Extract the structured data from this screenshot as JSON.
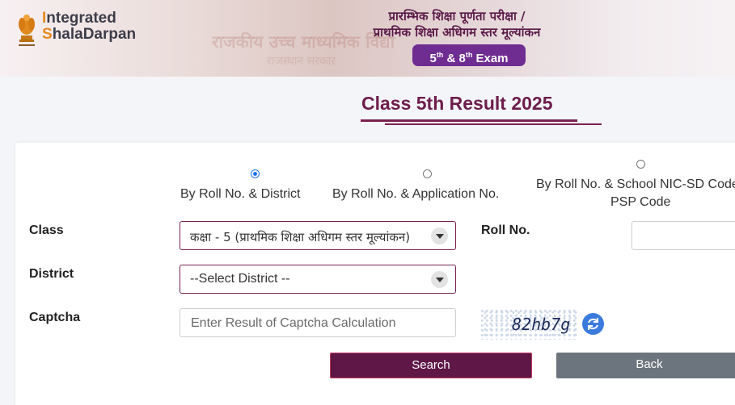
{
  "header": {
    "logo_line1_initial": "I",
    "logo_line1_rest": "ntegrated",
    "logo_line2_initial": "S",
    "logo_line2_rest": "halaDarpan",
    "exam_title_line1": "प्रारम्भिक शिक्षा पूर्णता परीक्षा /",
    "exam_title_line2": "प्राथमिक शिक्षा अधिगम स्तर मूल्यांकन",
    "badge_a": "5",
    "badge_a_sup": "th",
    "badge_mid": " & 8",
    "badge_b_sup": "th",
    "badge_end": " Exam",
    "background_text": "राजकीय उच्च माध्यमिक विद्या",
    "background_text2": "राजस्थान सरकार"
  },
  "page": {
    "title": "Class 5th Result 2025"
  },
  "search_options": [
    {
      "label": "By Roll No. & District",
      "selected": true
    },
    {
      "label": "By Roll No. & Application No.",
      "selected": false
    },
    {
      "label_line1": "By Roll No. & School NIC-SD Code",
      "label_line2": "PSP Code",
      "selected": false
    }
  ],
  "form": {
    "class_label": "Class",
    "class_value": "कक्षा - 5 (प्राथमिक शिक्षा अधिगम स्तर मूल्यांकन)",
    "roll_label": "Roll No.",
    "roll_value": "",
    "district_label": "District",
    "district_value": "--Select District --",
    "captcha_label": "Captcha",
    "captcha_placeholder": "Enter Result of Captcha Calculation",
    "captcha_text": "82hb7g"
  },
  "buttons": {
    "search": "Search",
    "back": "Back"
  },
  "colors": {
    "accent": "#6d1d4c",
    "badge": "#6f2c91",
    "search_button": "#5e1747",
    "back_button": "#6c757d",
    "refresh": "#3b7bdc"
  },
  "icons": {
    "emblem": "national-emblem-icon",
    "dropdown": "chevron-down-icon",
    "refresh": "refresh-icon"
  }
}
